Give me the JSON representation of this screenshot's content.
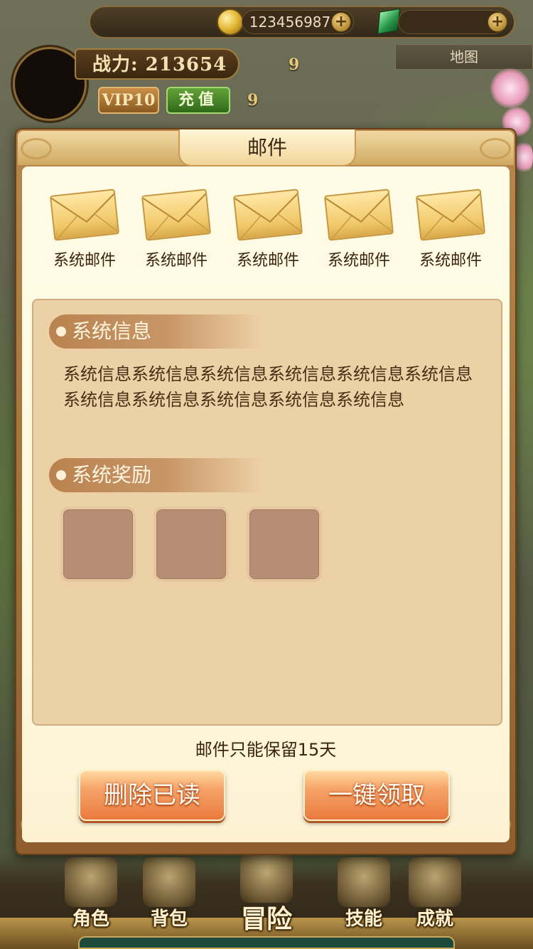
{
  "hud": {
    "gold_amount": "123456987",
    "plus_symbol": "+",
    "power_label": "战力: 213654",
    "level_number_1": "9",
    "level_number_2": "9",
    "vip_label": "VIP10",
    "recharge_label": "充值",
    "map_label": "地图"
  },
  "dialog": {
    "title": "邮件",
    "mails": [
      {
        "label": "系统邮件"
      },
      {
        "label": "系统邮件"
      },
      {
        "label": "系统邮件"
      },
      {
        "label": "系统邮件"
      },
      {
        "label": "系统邮件"
      }
    ],
    "info_section_title": "系统信息",
    "info_text": "系统信息系统信息系统信息系统信息系统信息系统信息系统信息系统信息系统信息系统信息系统信息",
    "reward_section_title": "系统奖励",
    "reward_slots": 3,
    "retention_note": "邮件只能保留15天",
    "delete_read_label": "删除已读",
    "claim_all_label": "一键领取"
  },
  "bottom_nav": {
    "items": [
      {
        "label": "角色",
        "icon": "helmet-icon"
      },
      {
        "label": "背包",
        "icon": "chest-icon"
      },
      {
        "label": "冒险",
        "icon": "crossed-swords-icon"
      },
      {
        "label": "技能",
        "icon": "skill-book-icon"
      },
      {
        "label": "成就",
        "icon": "scroll-icon"
      }
    ]
  },
  "colors": {
    "dialog_frame": "#b8874c",
    "panel_bg": "#ecd1a6",
    "button_orange": "#ea7a3e",
    "reward_slot": "#b78d73"
  }
}
